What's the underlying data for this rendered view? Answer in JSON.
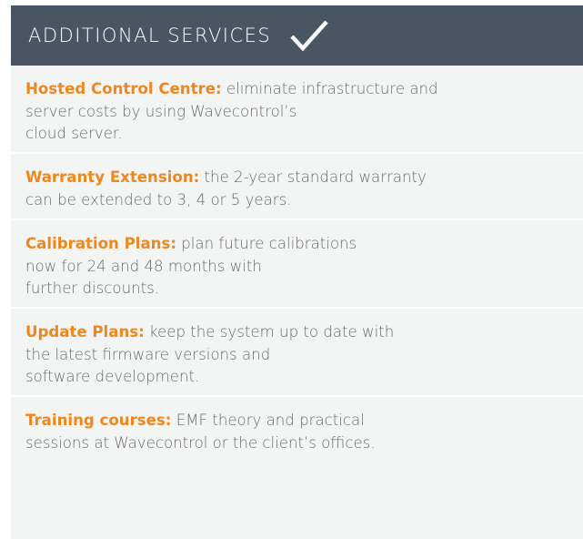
{
  "header": {
    "title": "ADDITIONAL SERVICES",
    "icon": "check-icon",
    "background": "#4a5563",
    "text_color": "#ffffff"
  },
  "accent_color": "#f0871c",
  "services": [
    {
      "title": "Hosted Control Centre:",
      "lines": [
        " eliminate infrastructure and",
        "server costs by using Wavecontrol’s",
        "cloud server."
      ]
    },
    {
      "title": "Warranty Extension:",
      "lines": [
        " the 2-year standard warranty",
        "can be extended to 3, 4 or 5 years."
      ]
    },
    {
      "title": "Calibration Plans:",
      "lines": [
        " plan future calibrations",
        "now for 24 and 48 months with",
        "further discounts."
      ]
    },
    {
      "title": "Update Plans:",
      "lines": [
        " keep the system up to date with",
        "the latest firmware versions and",
        "software development."
      ]
    },
    {
      "title": "Training courses:",
      "lines": [
        " EMF theory and practical",
        "sessions at Wavecontrol or the client’s offices."
      ]
    }
  ]
}
